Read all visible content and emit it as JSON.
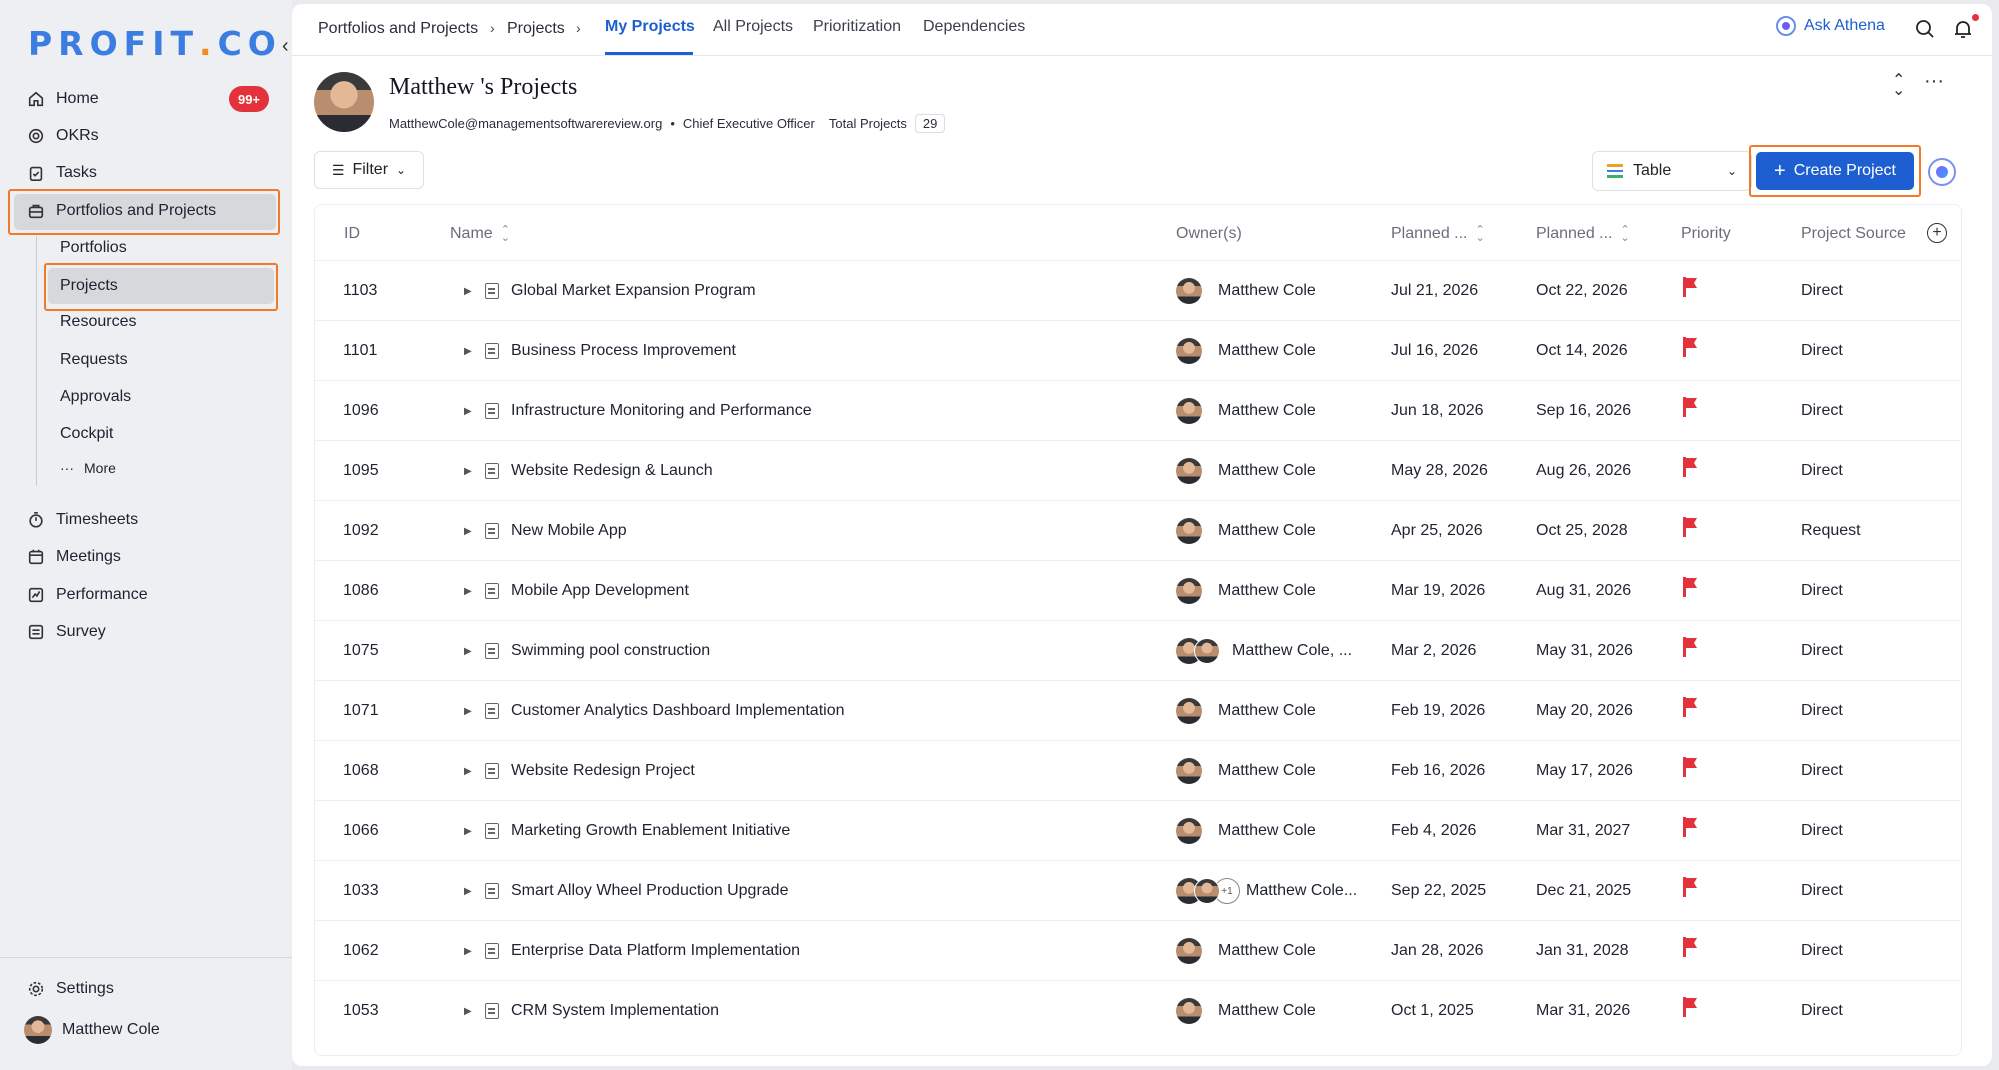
{
  "brand": {
    "logo_text_a": "PR",
    "logo_text_b": "O",
    "logo_text_c": "FIT",
    "logo_text_d": ".",
    "logo_text_e": "CO"
  },
  "sidebar": {
    "collapse_glyph": "‹",
    "items": [
      {
        "label": "Home",
        "icon": "home-icon"
      },
      {
        "label": "OKRs",
        "icon": "target-icon"
      },
      {
        "label": "Tasks",
        "icon": "clipboard-icon"
      },
      {
        "label": "Portfolios and Projects",
        "icon": "briefcase-icon"
      },
      {
        "label": "Timesheets",
        "icon": "stopwatch-icon"
      },
      {
        "label": "Meetings",
        "icon": "calendar-icon"
      },
      {
        "label": "Performance",
        "icon": "chart-icon"
      },
      {
        "label": "Survey",
        "icon": "survey-icon"
      }
    ],
    "home_badge": "99+",
    "sub_items": [
      "Portfolios",
      "Projects",
      "Resources",
      "Requests",
      "Approvals",
      "Cockpit"
    ],
    "more_label": "More",
    "more_glyph": "···",
    "settings_label": "Settings",
    "user_name": "Matthew Cole"
  },
  "topbar": {
    "breadcrumb": [
      "Portfolios and Projects",
      "Projects"
    ],
    "crumb_sep": "›",
    "tabs": [
      "My Projects",
      "All Projects",
      "Prioritization",
      "Dependencies"
    ],
    "ask_athena": "Ask Athena"
  },
  "header": {
    "title": "Matthew 's Projects",
    "email": "MatthewCole@managementsoftwarereview.org",
    "bullet": "•",
    "role": "Chief Executive Officer",
    "total_label": "Total Projects",
    "total_count": "29",
    "expand_glyph": "⌃⌄",
    "more_glyph": "···"
  },
  "toolbar": {
    "filter_label": "Filter",
    "view_label": "Table",
    "create_label": "Create Project",
    "chevron": "⌄"
  },
  "table": {
    "columns": [
      "ID",
      "Name",
      "Owner(s)",
      "Planned ...",
      "Planned ...",
      "Priority",
      "Project Source"
    ],
    "rows": [
      {
        "id": "1103",
        "name": "Global Market Expansion Program",
        "owner": "Matthew Cole",
        "start": "Jul 21, 2026",
        "end": "Oct 22, 2026",
        "source": "Direct",
        "owners": 1
      },
      {
        "id": "1101",
        "name": "Business Process Improvement",
        "owner": "Matthew Cole",
        "start": "Jul 16, 2026",
        "end": "Oct 14, 2026",
        "source": "Direct",
        "owners": 1
      },
      {
        "id": "1096",
        "name": "Infrastructure Monitoring and Performance",
        "owner": "Matthew Cole",
        "start": "Jun 18, 2026",
        "end": "Sep 16, 2026",
        "source": "Direct",
        "owners": 1
      },
      {
        "id": "1095",
        "name": "Website Redesign & Launch",
        "owner": "Matthew Cole",
        "start": "May 28, 2026",
        "end": "Aug 26, 2026",
        "source": "Direct",
        "owners": 1
      },
      {
        "id": "1092",
        "name": "New Mobile App",
        "owner": "Matthew Cole",
        "start": "Apr 25, 2026",
        "end": "Oct 25, 2028",
        "source": "Request",
        "owners": 1
      },
      {
        "id": "1086",
        "name": "Mobile App Development",
        "owner": "Matthew Cole",
        "start": "Mar 19, 2026",
        "end": "Aug 31, 2026",
        "source": "Direct",
        "owners": 1
      },
      {
        "id": "1075",
        "name": "Swimming pool construction",
        "owner": "Matthew Cole, ...",
        "start": "Mar 2, 2026",
        "end": "May 31, 2026",
        "source": "Direct",
        "owners": 2
      },
      {
        "id": "1071",
        "name": "Customer Analytics Dashboard Implementation",
        "owner": "Matthew Cole",
        "start": "Feb 19, 2026",
        "end": "May 20, 2026",
        "source": "Direct",
        "owners": 1
      },
      {
        "id": "1068",
        "name": "Website Redesign Project",
        "owner": "Matthew Cole",
        "start": "Feb 16, 2026",
        "end": "May 17, 2026",
        "source": "Direct",
        "owners": 1
      },
      {
        "id": "1066",
        "name": "Marketing Growth Enablement Initiative",
        "owner": "Matthew Cole",
        "start": "Feb 4, 2026",
        "end": "Mar 31, 2027",
        "source": "Direct",
        "owners": 1
      },
      {
        "id": "1033",
        "name": "Smart Alloy Wheel Production Upgrade",
        "owner": "Matthew Cole...",
        "start": "Sep 22, 2025",
        "end": "Dec 21, 2025",
        "source": "Direct",
        "owners": 3,
        "extra": "+1"
      },
      {
        "id": "1062",
        "name": "Enterprise Data Platform Implementation",
        "owner": "Matthew Cole",
        "start": "Jan 28, 2026",
        "end": "Jan 31, 2028",
        "source": "Direct",
        "owners": 1
      },
      {
        "id": "1053",
        "name": "CRM System Implementation",
        "owner": "Matthew Cole",
        "start": "Oct 1, 2025",
        "end": "Mar 31, 2026",
        "source": "Direct",
        "owners": 1
      }
    ]
  },
  "colors": {
    "accent": "#1d5fd0",
    "highlight": "#f07a2a",
    "flag": "#e3323c"
  }
}
